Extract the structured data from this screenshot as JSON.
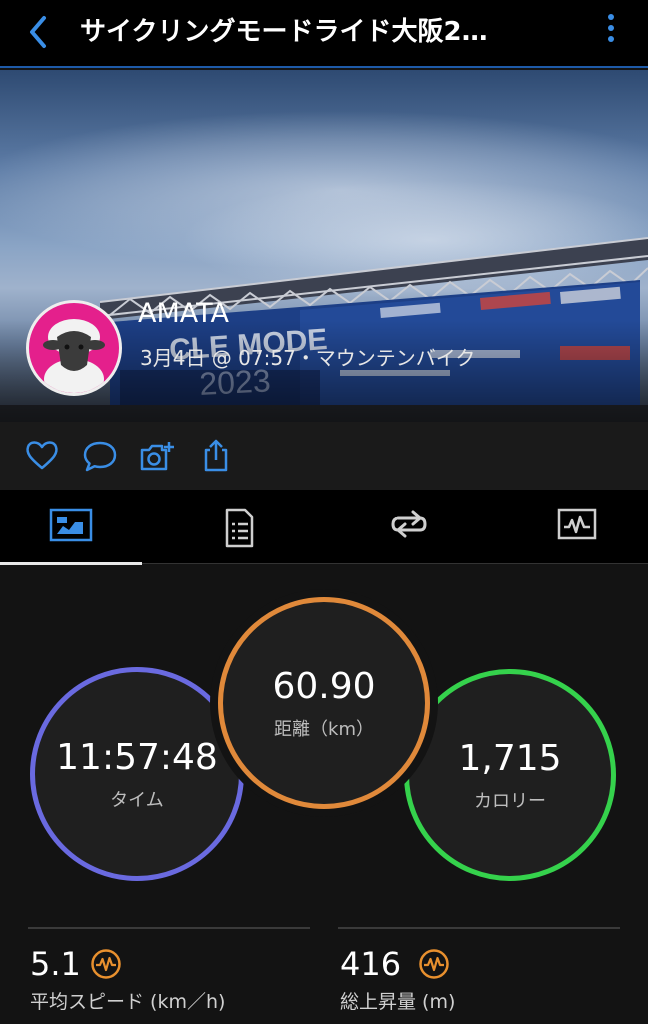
{
  "header": {
    "title": "サイクリングモードライド大阪2…",
    "back_icon": "chevron-left-icon",
    "menu_icon": "kebab-menu-icon"
  },
  "activity": {
    "user_name": "AMATA",
    "meta": "3月4日 @ 07:57・マウンテンバイク"
  },
  "actions": [
    "heart-icon",
    "comment-icon",
    "add-photo-icon",
    "share-icon"
  ],
  "tabs": [
    "stats-icon",
    "details-icon",
    "laps-icon",
    "chart-icon"
  ],
  "stats": {
    "time": {
      "value": "11:57:48",
      "label": "タイム"
    },
    "distance": {
      "value": "60.90",
      "label": "距離（km）"
    },
    "calories": {
      "value": "1,715",
      "label": "カロリー"
    },
    "avg_speed": {
      "value": "5.1",
      "label": "平均スピード (km／h)"
    },
    "elevation_gain": {
      "value": "416",
      "label": "総上昇量 (m)"
    }
  },
  "colors": {
    "accent": "#3a8ee6",
    "time_ring": "#6a6ae0",
    "distance_ring": "#e0893a",
    "calories_ring": "#35d24c",
    "perf_icon": "#e8902e"
  }
}
